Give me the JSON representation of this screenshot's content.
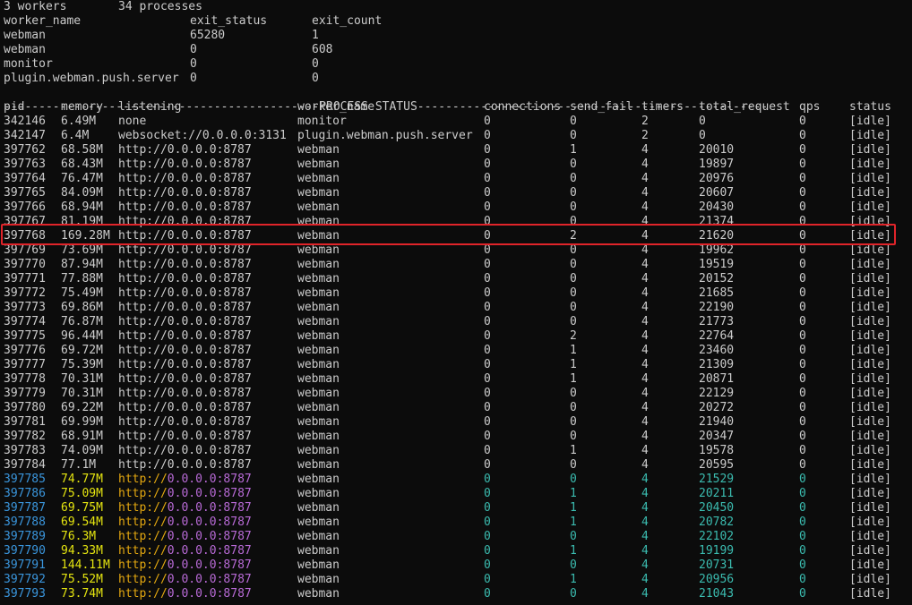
{
  "summary": {
    "workers": "3 workers",
    "processes": "34 processes"
  },
  "exit_header": {
    "worker_name": "worker_name",
    "exit_status": "exit_status",
    "exit_count": "exit_count"
  },
  "exit_rows": [
    {
      "worker_name": "webman",
      "exit_status": "65280",
      "exit_count": "1"
    },
    {
      "worker_name": "webman",
      "exit_status": "0",
      "exit_count": "608"
    },
    {
      "worker_name": "monitor",
      "exit_status": "0",
      "exit_count": "0"
    },
    {
      "worker_name": "plugin.webman.push.server",
      "exit_status": "0",
      "exit_count": "0"
    }
  ],
  "separator": "---------------------------------------------PROCESS STATUS--------------------------------------------------",
  "columns": {
    "pid": "pid",
    "memory": "memory",
    "listening": "listening",
    "worker_name": "worker_name",
    "connections": "connections",
    "send_fail": "send_fail",
    "timers": "timers",
    "total_request": "total_request",
    "qps": "qps",
    "status": "status"
  },
  "colors": {
    "text": "#cccccc",
    "pid_accent": "#3a96dd",
    "memory_accent": "#e5e510",
    "listening_prefix": "#e5a910",
    "listening_address": "#b86ad6",
    "numbers_accent": "#3bbcb0",
    "highlight_border": "#e0242a",
    "background": "#0c0c0c"
  },
  "processes": [
    {
      "pid": "342146",
      "memory": "6.49M",
      "listening": "none",
      "worker_name": "monitor",
      "connections": "0",
      "send_fail": "0",
      "timers": "2",
      "total_request": "0",
      "qps": "0",
      "status": "[idle]"
    },
    {
      "pid": "342147",
      "memory": "6.4M",
      "listening": "websocket://0.0.0.0:3131",
      "worker_name": "plugin.webman.push.server",
      "connections": "0",
      "send_fail": "0",
      "timers": "2",
      "total_request": "0",
      "qps": "0",
      "status": "[idle]"
    },
    {
      "pid": "397762",
      "memory": "68.58M",
      "listening": "http://0.0.0.0:8787",
      "worker_name": "webman",
      "connections": "0",
      "send_fail": "1",
      "timers": "4",
      "total_request": "20010",
      "qps": "0",
      "status": "[idle]"
    },
    {
      "pid": "397763",
      "memory": "68.43M",
      "listening": "http://0.0.0.0:8787",
      "worker_name": "webman",
      "connections": "0",
      "send_fail": "0",
      "timers": "4",
      "total_request": "19897",
      "qps": "0",
      "status": "[idle]"
    },
    {
      "pid": "397764",
      "memory": "76.47M",
      "listening": "http://0.0.0.0:8787",
      "worker_name": "webman",
      "connections": "0",
      "send_fail": "0",
      "timers": "4",
      "total_request": "20976",
      "qps": "0",
      "status": "[idle]"
    },
    {
      "pid": "397765",
      "memory": "84.09M",
      "listening": "http://0.0.0.0:8787",
      "worker_name": "webman",
      "connections": "0",
      "send_fail": "0",
      "timers": "4",
      "total_request": "20607",
      "qps": "0",
      "status": "[idle]"
    },
    {
      "pid": "397766",
      "memory": "68.94M",
      "listening": "http://0.0.0.0:8787",
      "worker_name": "webman",
      "connections": "0",
      "send_fail": "0",
      "timers": "4",
      "total_request": "20430",
      "qps": "0",
      "status": "[idle]"
    },
    {
      "pid": "397767",
      "memory": "81.19M",
      "listening": "http://0.0.0.0:8787",
      "worker_name": "webman",
      "connections": "0",
      "send_fail": "0",
      "timers": "4",
      "total_request": "21374",
      "qps": "0",
      "status": "[idle]"
    },
    {
      "pid": "397768",
      "memory": "169.28M",
      "listening": "http://0.0.0.0:8787",
      "worker_name": "webman",
      "connections": "0",
      "send_fail": "2",
      "timers": "4",
      "total_request": "21620",
      "qps": "0",
      "status": "[idle]",
      "highlighted": true
    },
    {
      "pid": "397769",
      "memory": "73.69M",
      "listening": "http://0.0.0.0:8787",
      "worker_name": "webman",
      "connections": "0",
      "send_fail": "0",
      "timers": "4",
      "total_request": "19962",
      "qps": "0",
      "status": "[idle]"
    },
    {
      "pid": "397770",
      "memory": "87.94M",
      "listening": "http://0.0.0.0:8787",
      "worker_name": "webman",
      "connections": "0",
      "send_fail": "0",
      "timers": "4",
      "total_request": "19519",
      "qps": "0",
      "status": "[idle]"
    },
    {
      "pid": "397771",
      "memory": "77.88M",
      "listening": "http://0.0.0.0:8787",
      "worker_name": "webman",
      "connections": "0",
      "send_fail": "0",
      "timers": "4",
      "total_request": "20152",
      "qps": "0",
      "status": "[idle]"
    },
    {
      "pid": "397772",
      "memory": "75.49M",
      "listening": "http://0.0.0.0:8787",
      "worker_name": "webman",
      "connections": "0",
      "send_fail": "0",
      "timers": "4",
      "total_request": "21685",
      "qps": "0",
      "status": "[idle]"
    },
    {
      "pid": "397773",
      "memory": "69.86M",
      "listening": "http://0.0.0.0:8787",
      "worker_name": "webman",
      "connections": "0",
      "send_fail": "0",
      "timers": "4",
      "total_request": "22190",
      "qps": "0",
      "status": "[idle]"
    },
    {
      "pid": "397774",
      "memory": "76.87M",
      "listening": "http://0.0.0.0:8787",
      "worker_name": "webman",
      "connections": "0",
      "send_fail": "0",
      "timers": "4",
      "total_request": "21773",
      "qps": "0",
      "status": "[idle]"
    },
    {
      "pid": "397775",
      "memory": "96.44M",
      "listening": "http://0.0.0.0:8787",
      "worker_name": "webman",
      "connections": "0",
      "send_fail": "2",
      "timers": "4",
      "total_request": "22764",
      "qps": "0",
      "status": "[idle]"
    },
    {
      "pid": "397776",
      "memory": "69.72M",
      "listening": "http://0.0.0.0:8787",
      "worker_name": "webman",
      "connections": "0",
      "send_fail": "1",
      "timers": "4",
      "total_request": "23460",
      "qps": "0",
      "status": "[idle]"
    },
    {
      "pid": "397777",
      "memory": "75.39M",
      "listening": "http://0.0.0.0:8787",
      "worker_name": "webman",
      "connections": "0",
      "send_fail": "1",
      "timers": "4",
      "total_request": "21309",
      "qps": "0",
      "status": "[idle]"
    },
    {
      "pid": "397778",
      "memory": "70.31M",
      "listening": "http://0.0.0.0:8787",
      "worker_name": "webman",
      "connections": "0",
      "send_fail": "1",
      "timers": "4",
      "total_request": "20871",
      "qps": "0",
      "status": "[idle]"
    },
    {
      "pid": "397779",
      "memory": "70.31M",
      "listening": "http://0.0.0.0:8787",
      "worker_name": "webman",
      "connections": "0",
      "send_fail": "0",
      "timers": "4",
      "total_request": "22129",
      "qps": "0",
      "status": "[idle]"
    },
    {
      "pid": "397780",
      "memory": "69.22M",
      "listening": "http://0.0.0.0:8787",
      "worker_name": "webman",
      "connections": "0",
      "send_fail": "0",
      "timers": "4",
      "total_request": "20272",
      "qps": "0",
      "status": "[idle]"
    },
    {
      "pid": "397781",
      "memory": "69.99M",
      "listening": "http://0.0.0.0:8787",
      "worker_name": "webman",
      "connections": "0",
      "send_fail": "0",
      "timers": "4",
      "total_request": "21940",
      "qps": "0",
      "status": "[idle]"
    },
    {
      "pid": "397782",
      "memory": "68.91M",
      "listening": "http://0.0.0.0:8787",
      "worker_name": "webman",
      "connections": "0",
      "send_fail": "0",
      "timers": "4",
      "total_request": "20347",
      "qps": "0",
      "status": "[idle]"
    },
    {
      "pid": "397783",
      "memory": "74.09M",
      "listening": "http://0.0.0.0:8787",
      "worker_name": "webman",
      "connections": "0",
      "send_fail": "1",
      "timers": "4",
      "total_request": "19578",
      "qps": "0",
      "status": "[idle]"
    },
    {
      "pid": "397784",
      "memory": "77.1M",
      "listening": "http://0.0.0.0:8787",
      "worker_name": "webman",
      "connections": "0",
      "send_fail": "0",
      "timers": "4",
      "total_request": "20595",
      "qps": "0",
      "status": "[idle]"
    },
    {
      "pid": "397785",
      "memory": "74.77M",
      "listening": "http://0.0.0.0:8787",
      "worker_name": "webman",
      "connections": "0",
      "send_fail": "0",
      "timers": "4",
      "total_request": "21529",
      "qps": "0",
      "status": "[idle]",
      "colored": true
    },
    {
      "pid": "397786",
      "memory": "75.09M",
      "listening": "http://0.0.0.0:8787",
      "worker_name": "webman",
      "connections": "0",
      "send_fail": "1",
      "timers": "4",
      "total_request": "20211",
      "qps": "0",
      "status": "[idle]",
      "colored": true
    },
    {
      "pid": "397787",
      "memory": "69.75M",
      "listening": "http://0.0.0.0:8787",
      "worker_name": "webman",
      "connections": "0",
      "send_fail": "1",
      "timers": "4",
      "total_request": "20450",
      "qps": "0",
      "status": "[idle]",
      "colored": true
    },
    {
      "pid": "397788",
      "memory": "69.54M",
      "listening": "http://0.0.0.0:8787",
      "worker_name": "webman",
      "connections": "0",
      "send_fail": "1",
      "timers": "4",
      "total_request": "20782",
      "qps": "0",
      "status": "[idle]",
      "colored": true
    },
    {
      "pid": "397789",
      "memory": "76.3M",
      "listening": "http://0.0.0.0:8787",
      "worker_name": "webman",
      "connections": "0",
      "send_fail": "0",
      "timers": "4",
      "total_request": "22102",
      "qps": "0",
      "status": "[idle]",
      "colored": true
    },
    {
      "pid": "397790",
      "memory": "94.33M",
      "listening": "http://0.0.0.0:8787",
      "worker_name": "webman",
      "connections": "0",
      "send_fail": "1",
      "timers": "4",
      "total_request": "19199",
      "qps": "0",
      "status": "[idle]",
      "colored": true
    },
    {
      "pid": "397791",
      "memory": "144.11M",
      "listening": "http://0.0.0.0:8787",
      "worker_name": "webman",
      "connections": "0",
      "send_fail": "0",
      "timers": "4",
      "total_request": "20731",
      "qps": "0",
      "status": "[idle]",
      "colored": true
    },
    {
      "pid": "397792",
      "memory": "75.52M",
      "listening": "http://0.0.0.0:8787",
      "worker_name": "webman",
      "connections": "0",
      "send_fail": "1",
      "timers": "4",
      "total_request": "20956",
      "qps": "0",
      "status": "[idle]",
      "colored": true
    },
    {
      "pid": "397793",
      "memory": "73.74M",
      "listening": "http://0.0.0.0:8787",
      "worker_name": "webman",
      "connections": "0",
      "send_fail": "0",
      "timers": "4",
      "total_request": "21043",
      "qps": "0",
      "status": "[idle]",
      "colored": true
    }
  ]
}
